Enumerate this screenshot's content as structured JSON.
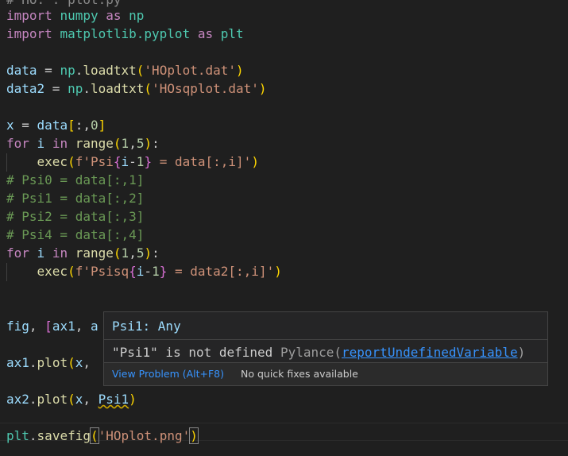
{
  "code": {
    "top_partial": "# HO. . plot.py",
    "lines": [
      {
        "tokens": [
          [
            "kw",
            "import"
          ],
          [
            "op",
            " "
          ],
          [
            "mod",
            "numpy"
          ],
          [
            "op",
            " "
          ],
          [
            "kw",
            "as"
          ],
          [
            "op",
            " "
          ],
          [
            "mod",
            "np"
          ]
        ]
      },
      {
        "tokens": [
          [
            "kw",
            "import"
          ],
          [
            "op",
            " "
          ],
          [
            "mod",
            "matplotlib.pyplot"
          ],
          [
            "op",
            " "
          ],
          [
            "kw",
            "as"
          ],
          [
            "op",
            " "
          ],
          [
            "mod",
            "plt"
          ]
        ]
      },
      {
        "tokens": []
      },
      {
        "tokens": [
          [
            "var",
            "data"
          ],
          [
            "op",
            " = "
          ],
          [
            "mod",
            "np"
          ],
          [
            "op",
            "."
          ],
          [
            "fn",
            "loadtxt"
          ],
          [
            "bry",
            "("
          ],
          [
            "str",
            "'HOplot.dat'"
          ],
          [
            "bry",
            ")"
          ]
        ]
      },
      {
        "tokens": [
          [
            "var",
            "data2"
          ],
          [
            "op",
            " = "
          ],
          [
            "mod",
            "np"
          ],
          [
            "op",
            "."
          ],
          [
            "fn",
            "loadtxt"
          ],
          [
            "bry",
            "("
          ],
          [
            "str",
            "'HOsqplot.dat'"
          ],
          [
            "bry",
            ")"
          ]
        ]
      },
      {
        "tokens": []
      },
      {
        "tokens": [
          [
            "var",
            "x"
          ],
          [
            "op",
            " = "
          ],
          [
            "var",
            "data"
          ],
          [
            "bry",
            "["
          ],
          [
            "op",
            ":,"
          ],
          [
            "num",
            "0"
          ],
          [
            "bry",
            "]"
          ]
        ]
      },
      {
        "tokens": [
          [
            "kw",
            "for"
          ],
          [
            "op",
            " "
          ],
          [
            "var",
            "i"
          ],
          [
            "op",
            " "
          ],
          [
            "kw",
            "in"
          ],
          [
            "op",
            " "
          ],
          [
            "fn",
            "range"
          ],
          [
            "bry",
            "("
          ],
          [
            "num",
            "1"
          ],
          [
            "op",
            ","
          ],
          [
            "num",
            "5"
          ],
          [
            "bry",
            ")"
          ],
          [
            "op",
            ":"
          ]
        ]
      },
      {
        "tokens": [
          [
            "op",
            "    "
          ],
          [
            "fn",
            "exec"
          ],
          [
            "bry",
            "("
          ],
          [
            "str",
            "f'Psi"
          ],
          [
            "brp",
            "{"
          ],
          [
            "var",
            "i"
          ],
          [
            "op",
            "-"
          ],
          [
            "num",
            "1"
          ],
          [
            "brp",
            "}"
          ],
          [
            "str",
            " = data[:,i]'"
          ],
          [
            "bry",
            ")"
          ]
        ]
      },
      {
        "tokens": [
          [
            "com",
            "# Psi0 = data[:,1]"
          ]
        ]
      },
      {
        "tokens": [
          [
            "com",
            "# Psi1 = data[:,2]"
          ]
        ]
      },
      {
        "tokens": [
          [
            "com",
            "# Psi2 = data[:,3]"
          ]
        ]
      },
      {
        "tokens": [
          [
            "com",
            "# Psi4 = data[:,4]"
          ]
        ]
      },
      {
        "tokens": [
          [
            "kw",
            "for"
          ],
          [
            "op",
            " "
          ],
          [
            "var",
            "i"
          ],
          [
            "op",
            " "
          ],
          [
            "kw",
            "in"
          ],
          [
            "op",
            " "
          ],
          [
            "fn",
            "range"
          ],
          [
            "bry",
            "("
          ],
          [
            "num",
            "1"
          ],
          [
            "op",
            ","
          ],
          [
            "num",
            "5"
          ],
          [
            "bry",
            ")"
          ],
          [
            "op",
            ":"
          ]
        ]
      },
      {
        "tokens": [
          [
            "op",
            "    "
          ],
          [
            "fn",
            "exec"
          ],
          [
            "bry",
            "("
          ],
          [
            "str",
            "f'Psisq"
          ],
          [
            "brp",
            "{"
          ],
          [
            "var",
            "i"
          ],
          [
            "op",
            "-"
          ],
          [
            "num",
            "1"
          ],
          [
            "brp",
            "}"
          ],
          [
            "str",
            " = data2[:,i]'"
          ],
          [
            "bry",
            ")"
          ]
        ]
      },
      {
        "tokens": []
      },
      {
        "tokens": []
      },
      {
        "tokens": [
          [
            "var",
            "fig"
          ],
          [
            "op",
            ", "
          ],
          [
            "brp",
            "["
          ],
          [
            "var",
            "ax1"
          ],
          [
            "op",
            ", "
          ],
          [
            "var",
            "a"
          ]
        ]
      },
      {
        "tokens": []
      },
      {
        "tokens": [
          [
            "var",
            "ax1"
          ],
          [
            "op",
            "."
          ],
          [
            "fn",
            "plot"
          ],
          [
            "bry",
            "("
          ],
          [
            "var",
            "x"
          ],
          [
            "op",
            ", "
          ]
        ]
      },
      {
        "tokens": []
      },
      {
        "tokens": [
          [
            "var",
            "ax2"
          ],
          [
            "op",
            "."
          ],
          [
            "fn",
            "plot"
          ],
          [
            "bry",
            "("
          ],
          [
            "var",
            "x"
          ],
          [
            "op",
            ", "
          ],
          [
            "var squiggle",
            "Psi1"
          ],
          [
            "bry",
            ")"
          ]
        ]
      },
      {
        "tokens": []
      },
      {
        "tokens": [
          [
            "mod",
            "plt"
          ],
          [
            "op",
            "."
          ],
          [
            "fn",
            "savefig"
          ],
          [
            "bry match",
            "("
          ],
          [
            "str",
            "'HOplot.png'"
          ],
          [
            "bry match",
            ")"
          ]
        ]
      }
    ]
  },
  "hover": {
    "signature": "Psi1: Any",
    "message": "\"Psi1\" is not defined",
    "source": "Pylance",
    "rule_open": "(",
    "rule": "reportUndefinedVariable",
    "rule_close": ")",
    "view_problem": "View Problem (Alt+F8)",
    "no_fixes": "No quick fixes available"
  }
}
